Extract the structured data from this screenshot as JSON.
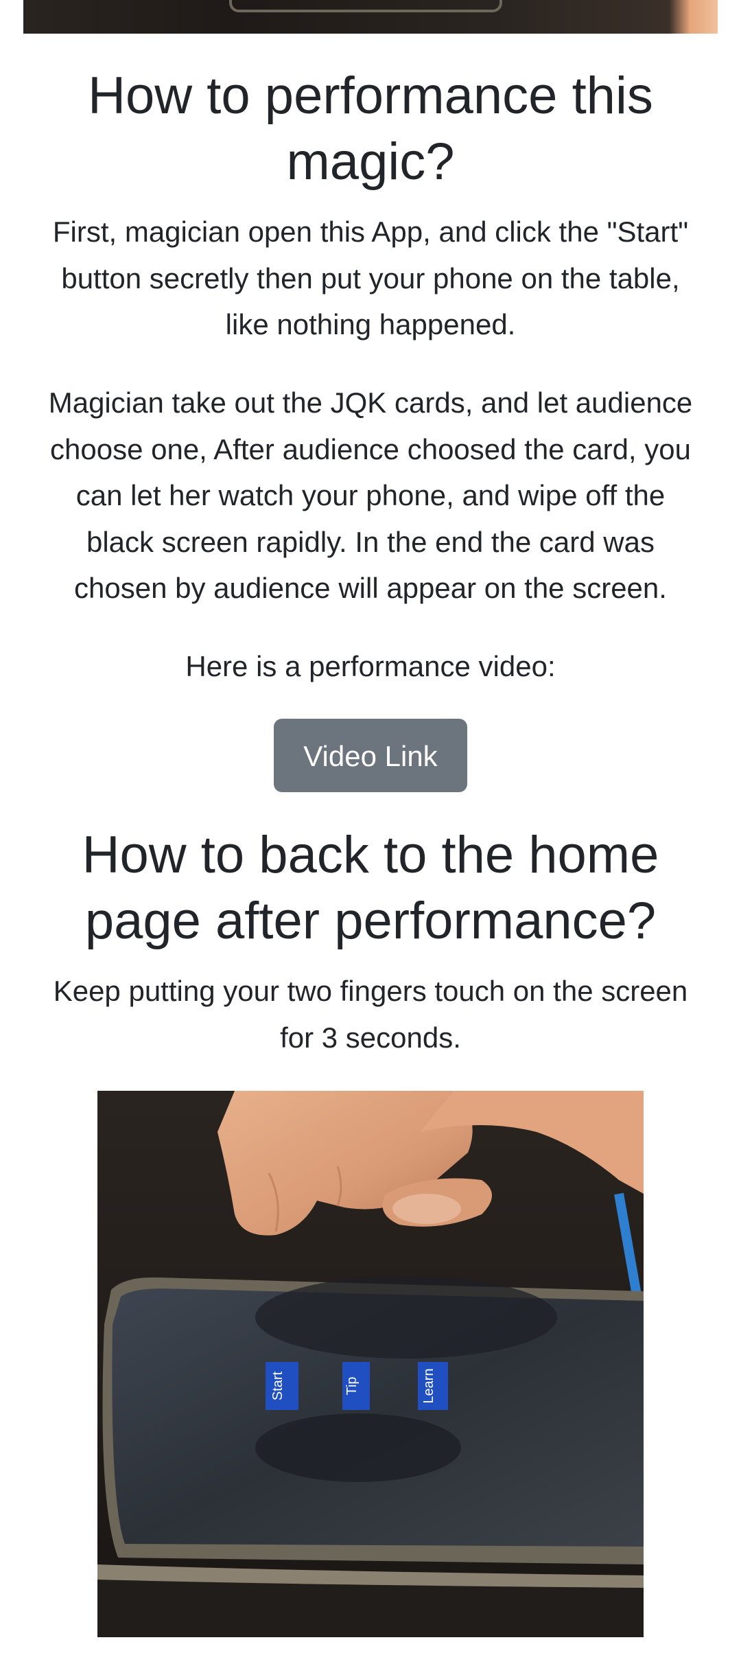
{
  "section1": {
    "title_line1": "How to performance this",
    "title_line2": "magic?",
    "para1_lines": [
      "First, magician open this App, and click the \"Start\"",
      "button secretly then put your phone on the table,",
      "like nothing happened."
    ],
    "para2_lines": [
      "Magician take out the JQK cards, and let audience",
      "choose one, After audience choosed the card, you",
      "can let her watch your phone, and wipe off the",
      "black screen rapidly. In the end the card was",
      "chosen by audience will appear on the screen."
    ],
    "video_intro": "Here is a performance video:",
    "video_button": "Video Link"
  },
  "section2": {
    "title_line1": "How to back to the home",
    "title_line2": "page after performance?",
    "para_lines": [
      "Keep putting your two fingers touch on the screen",
      "for 3 seconds."
    ]
  },
  "photo": {
    "app_buttons": [
      "Start",
      "Tip",
      "Learn"
    ],
    "accent_color": "#1f4fc0"
  }
}
